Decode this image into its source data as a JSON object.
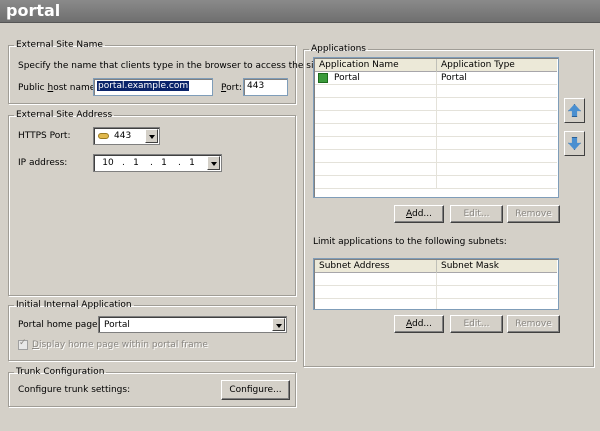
{
  "window": {
    "title": "portal"
  },
  "external_site_name": {
    "legend": "External Site Name",
    "description": "Specify the name that clients type in the browser to access the site.",
    "host_label_pre": "Public ",
    "host_label_accel": "h",
    "host_label_post": "ost name:",
    "host_value": "portal.example.com",
    "port_label_accel": "P",
    "port_label_post": "ort:",
    "port_value": "443"
  },
  "external_site_address": {
    "legend": "External Site Address",
    "https_port_label": "HTTPS Port:",
    "https_port_value": "443",
    "ip_label": "IP address:",
    "ip_octets": [
      "10",
      "1",
      "1",
      "1"
    ]
  },
  "initial_internal_application": {
    "legend": "Initial Internal Application",
    "home_page_label": "Portal home page:",
    "home_page_value": "Portal",
    "checkbox_accel": "D",
    "checkbox_label": "isplay home page within portal frame",
    "checkbox_checked": true
  },
  "trunk_configuration": {
    "legend": "Trunk Configuration",
    "label": "Configure trunk settings:",
    "configure_button": "Configure..."
  },
  "applications": {
    "legend": "Applications",
    "columns": [
      "Application Name",
      "Application Type"
    ],
    "rows": [
      {
        "name": "Portal",
        "type": "Portal",
        "icon": "portal-app-icon"
      }
    ],
    "add_accel": "A",
    "add_label": "dd...",
    "edit_label": "Edit...",
    "remove_label": "Remove",
    "subnets_label": "Limit applications to the following subnets:",
    "subnet_columns": [
      "Subnet Address",
      "Subnet Mask"
    ],
    "subnet_add_accel": "A",
    "subnet_add_label": "dd...",
    "subnet_edit_label": "Edit...",
    "subnet_remove_label": "Remove"
  },
  "colors": {
    "title_bar": "#7a7a7a",
    "dialog_bg": "#d4d0c8",
    "selection": "#0a246a",
    "arrow_blue": "#4a8fd0"
  }
}
